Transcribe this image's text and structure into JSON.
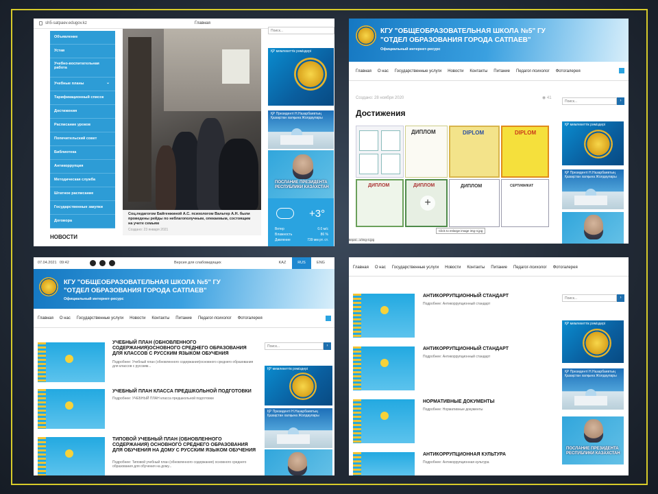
{
  "p1": {
    "url": "sh5-satpaev.edugov.kz",
    "page_title": "Главная",
    "menu": [
      "Объявление",
      "Устав",
      "Учебно-воспитательная работа",
      "Учебные планы",
      "Тарификационный список",
      "Достижения",
      "Расписание уроков",
      "Попечительский совет",
      "Библиотека",
      "Антикоррупция",
      "Методическая служба",
      "Штатное расписание",
      "Государственные закупки",
      "Договора"
    ],
    "news_heading": "НОВОСТИ",
    "caption": "Соц.педагогом Байгенжиной А.С. психологом Вальтер А.Н. были проведены рейды по неблагополучным, опекаемым, состоящим на учете семьям",
    "caption_date": "Создано: 23 января 2021",
    "search_placeholder": "Поиск...",
    "banner1": "ҚР мемлекеттік рәміздері",
    "banner2": "ҚР Президенті Н.Назарбаевтың Қазақстан халқына Жолдаулары",
    "banner3": "ПОСЛАНИЕ ПРЕЗИДЕНТА РЕСПУБЛИКИ КАЗАХСТАН",
    "weather": {
      "temp": "+3°",
      "wind_label": "Ветер",
      "wind": "0.0 м/с",
      "hum_label": "Влажность",
      "hum": "86 %",
      "pres_label": "Давление",
      "pres": "739 мм рт. ст."
    }
  },
  "header": {
    "line1": "КГУ \"ОБЩЕОБРАЗОВАТЕЛЬНАЯ ШКОЛА №5\" ГУ",
    "line2": "\"ОТДЕЛ ОБРАЗОВАНИЯ ГОРОДА САТПАЕВ\"",
    "sub": "Официальный интернет-ресурс"
  },
  "nav": [
    "Главная",
    "О нас",
    "Государственные услуги",
    "Новости",
    "Контакты",
    "Питание",
    "Педагог-психолог",
    "Фотогалерея"
  ],
  "p2": {
    "created": "Создано: 28 ноября 2020",
    "views": "41",
    "heading": "Достижения",
    "tooltip": "Click to enlarge image img-4.jpg",
    "status": "вера/...1/img-4.jpg",
    "dipl_labels": [
      "ДИПЛОМ",
      "DIPLOM",
      "DIPLOM",
      "ДИПЛОМ",
      "ДИПЛОМ",
      "ДИПЛОМ",
      "СЕРТИФИКАТ"
    ]
  },
  "p3": {
    "date": "07.04.2021",
    "time": "09:42",
    "accessibility": "Версия для слабовидящих",
    "langs": [
      "KAZ",
      "RUS",
      "ENG"
    ],
    "items": [
      {
        "title": "УЧЕБНЫЙ ПЛАН (ОБНОВЛЕННОГО СОДЕРЖАНИЯ)ОСНОВНОГО СРЕДНЕГО ОБРАЗОВАНИЯ ДЛЯ КЛАССОВ С РУССКИМ ЯЗЫКОМ ОБУЧЕНИЯ",
        "more": "Подробнее: Учебный план (обновленного содержания)основного среднего образования для классов с русским..."
      },
      {
        "title": "УЧЕБНЫЙ ПЛАН КЛАССА ПРЕДШКОЛЬНОЙ ПОДГОТОВКИ",
        "more": "Подробнее: УЧЕБНЫЙ ПЛАН класса предшкольной подготовки"
      },
      {
        "title": "ТИПОВОЙ УЧЕБНЫЙ ПЛАН (ОБНОВЛЕННОГО СОДЕРЖАНИЯ) ОСНОВНОГО СРЕДНЕГО ОБРАЗОВАНИЯ ДЛЯ ОБУЧЕНИЯ НА ДОМУ С РУССКИМ ЯЗЫКОМ ОБУЧЕНИЯ",
        "more": "Подробнее: Типовой учебный план (обновленного содержания) основного среднего образования для обучения на дому..."
      }
    ]
  },
  "p4": {
    "items": [
      {
        "title": "АНТИКОРРУПЦИОННЫЙ СТАНДАРТ",
        "more": "Подробнее: Антикоррупционный стандарт"
      },
      {
        "title": "АНТИКОРРУПЦИОННЫЙ СТАНДАРТ",
        "more": "Подробнее: Антикоррупционный стандарт"
      },
      {
        "title": "НОРМАТИВНЫЕ ДОКУМЕНТЫ",
        "more": "Подробнее: Нормативные документы"
      },
      {
        "title": "АНТИКОРРУПЦИОННАЯ КУЛЬТУРА",
        "more": "Подробнее: Антикоррупционная культура"
      }
    ]
  }
}
